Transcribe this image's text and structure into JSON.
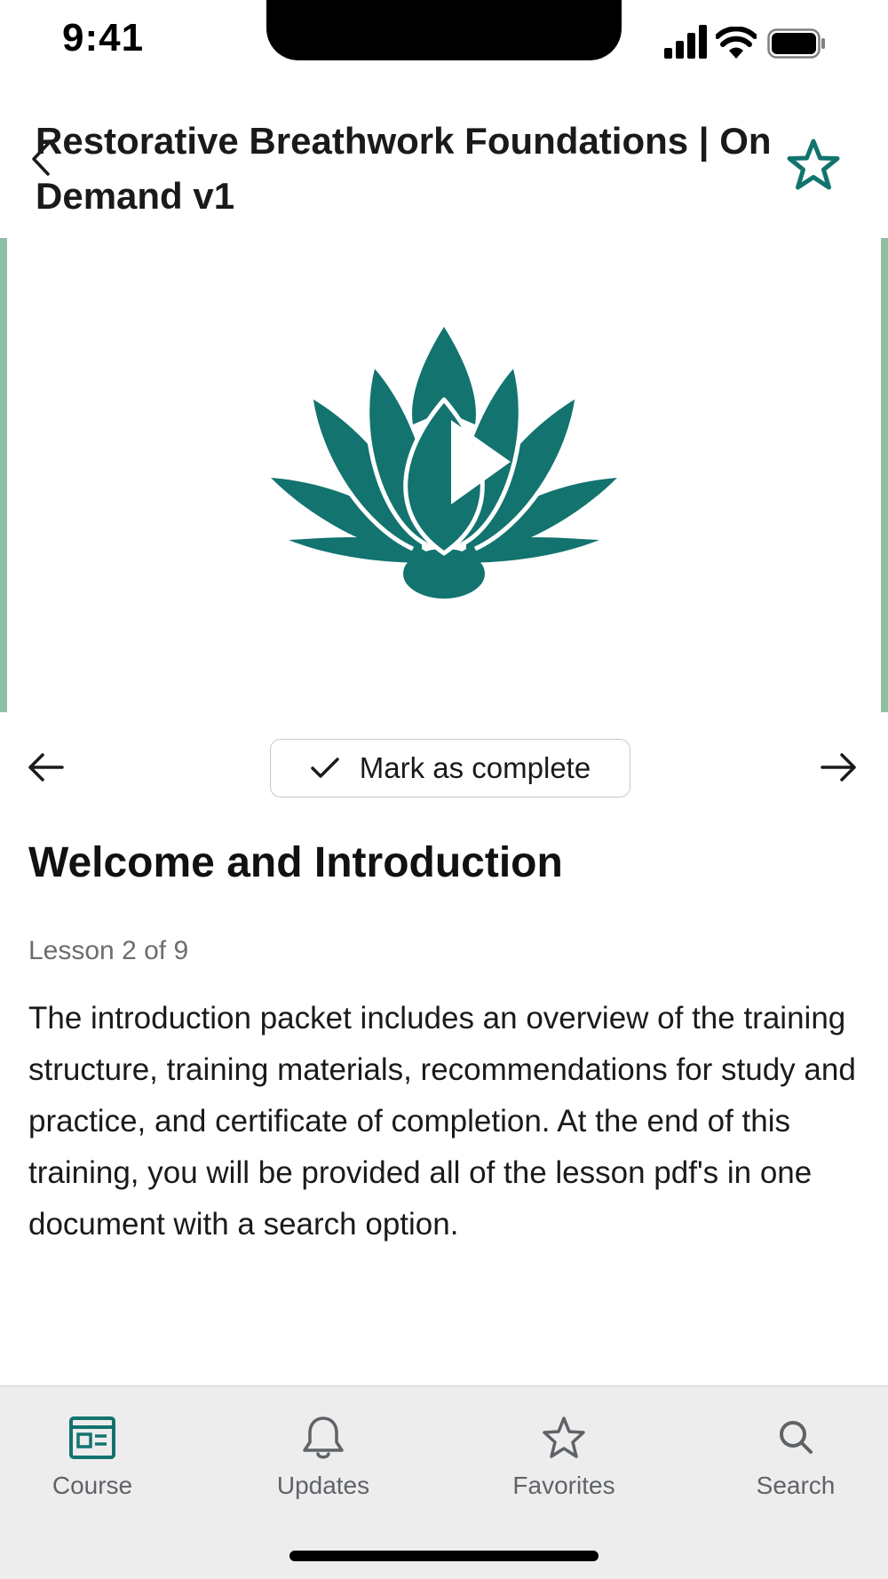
{
  "status_bar": {
    "time": "9:41"
  },
  "header": {
    "title": "Restorative Breathwork Foundations | On Demand v1",
    "back_icon": "chevron-left-icon",
    "favorite_icon": "star-outline-icon"
  },
  "media": {
    "thumbnail_icon": "lotus-logo-icon",
    "play_icon": "play-icon"
  },
  "lesson_nav": {
    "complete_label": "Mark as complete",
    "prev_icon": "arrow-left-icon",
    "next_icon": "arrow-right-icon"
  },
  "lesson": {
    "title": "Welcome and Introduction",
    "count": "Lesson 2 of 9",
    "description": "The introduction packet includes an overview of the training structure, training materials, recommendations for study and practice, and certificate of completion. At the end of this training, you will be provided all of the lesson pdf's in one document with a search option."
  },
  "tabs": [
    {
      "label": "Course",
      "icon": "course-icon",
      "active": true
    },
    {
      "label": "Updates",
      "icon": "bell-icon",
      "active": false
    },
    {
      "label": "Favorites",
      "icon": "star-icon",
      "active": false
    },
    {
      "label": "Search",
      "icon": "search-icon",
      "active": false
    }
  ],
  "colors": {
    "accent": "#12736f",
    "edge": "#8fbfa3",
    "tab_inactive": "#5f6368",
    "tab_bar_bg": "#ededed"
  }
}
